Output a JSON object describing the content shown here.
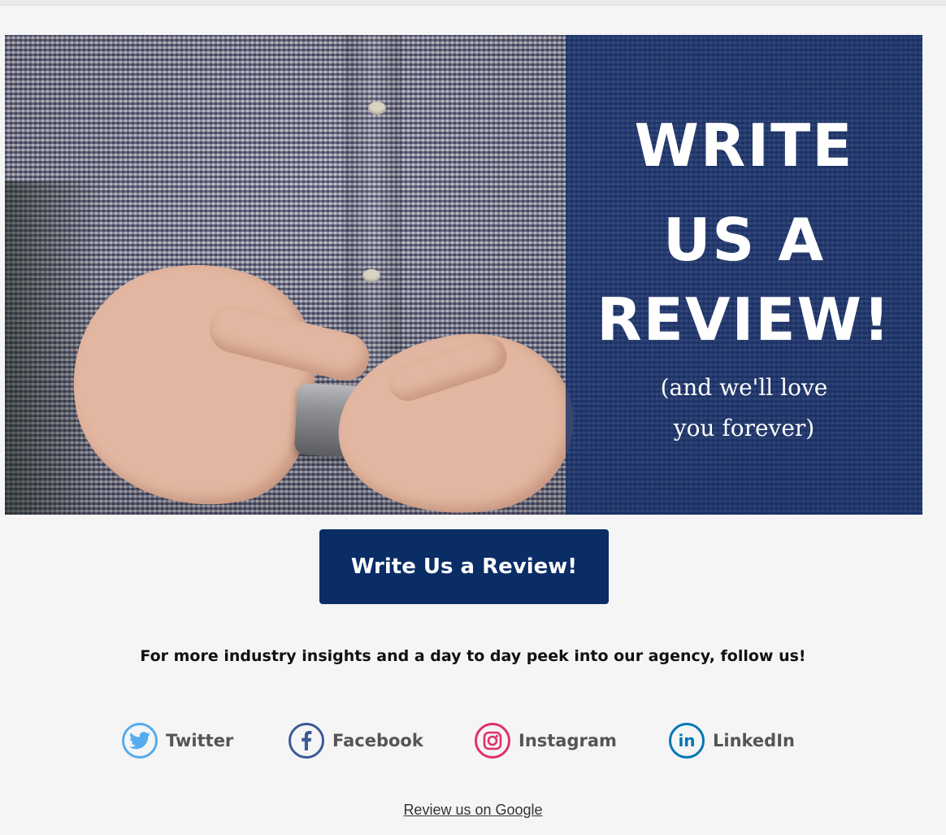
{
  "hero": {
    "headline_lines": [
      "WRITE",
      "US A",
      "REVIEW!"
    ],
    "subline_lines": [
      "(and we'll love",
      "you forever)"
    ],
    "overlay_color": "#122d69"
  },
  "cta": {
    "label": "Write Us a Review!",
    "color": "#0b2d66"
  },
  "follow_text": "For more industry insights and a day to day peek into our agency, follow us!",
  "socials": [
    {
      "label": "Twitter",
      "icon": "twitter-icon",
      "color": "#55acee"
    },
    {
      "label": "Facebook",
      "icon": "facebook-icon",
      "color": "#3b5998"
    },
    {
      "label": "Instagram",
      "icon": "instagram-icon",
      "color": "#e1306c"
    },
    {
      "label": "LinkedIn",
      "icon": "linkedin-icon",
      "color": "#0077b5"
    }
  ],
  "google_link": "Review us on Google"
}
